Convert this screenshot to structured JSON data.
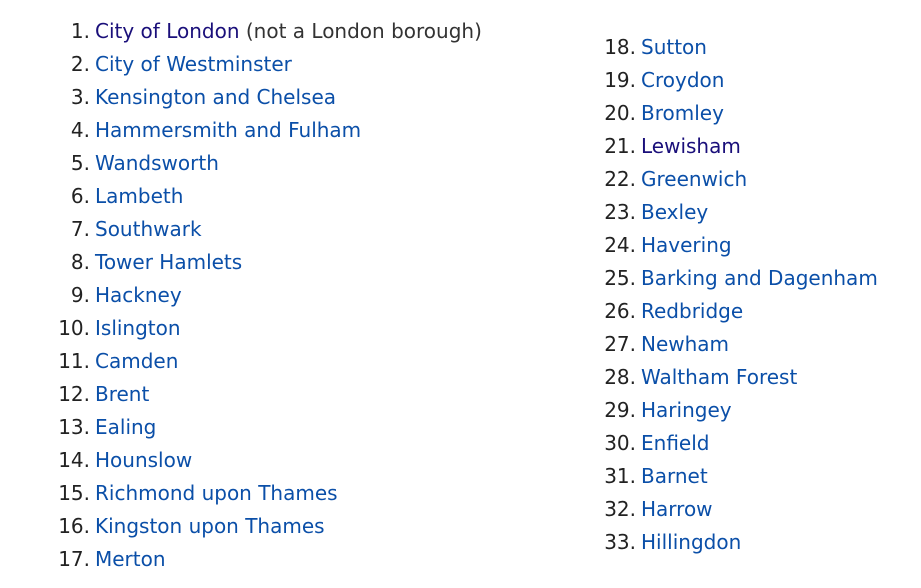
{
  "colors": {
    "link": "#0b4fa8",
    "visited_link": "#1a0f7a",
    "text": "#222222"
  },
  "left_list": [
    {
      "num": "1.",
      "name": "City of London",
      "note": " (not a London borough)",
      "visited": true
    },
    {
      "num": "2.",
      "name": "City of Westminster"
    },
    {
      "num": "3.",
      "name": "Kensington and Chelsea"
    },
    {
      "num": "4.",
      "name": "Hammersmith and Fulham"
    },
    {
      "num": "5.",
      "name": "Wandsworth"
    },
    {
      "num": "6.",
      "name": "Lambeth"
    },
    {
      "num": "7.",
      "name": "Southwark"
    },
    {
      "num": "8.",
      "name": "Tower Hamlets"
    },
    {
      "num": "9.",
      "name": "Hackney"
    },
    {
      "num": "10.",
      "name": "Islington"
    },
    {
      "num": "11.",
      "name": "Camden"
    },
    {
      "num": "12.",
      "name": "Brent"
    },
    {
      "num": "13.",
      "name": "Ealing"
    },
    {
      "num": "14.",
      "name": "Hounslow"
    },
    {
      "num": "15.",
      "name": "Richmond upon Thames"
    },
    {
      "num": "16.",
      "name": "Kingston upon Thames"
    },
    {
      "num": "17.",
      "name": "Merton"
    }
  ],
  "right_list": [
    {
      "num": "18.",
      "name": "Sutton"
    },
    {
      "num": "19.",
      "name": "Croydon"
    },
    {
      "num": "20.",
      "name": "Bromley"
    },
    {
      "num": "21.",
      "name": "Lewisham",
      "visited": true
    },
    {
      "num": "22.",
      "name": "Greenwich"
    },
    {
      "num": "23.",
      "name": "Bexley"
    },
    {
      "num": "24.",
      "name": "Havering"
    },
    {
      "num": "25.",
      "name": "Barking and Dagenham"
    },
    {
      "num": "26.",
      "name": "Redbridge"
    },
    {
      "num": "27.",
      "name": "Newham"
    },
    {
      "num": "28.",
      "name": "Waltham Forest"
    },
    {
      "num": "29.",
      "name": "Haringey"
    },
    {
      "num": "30.",
      "name": "Enfield"
    },
    {
      "num": "31.",
      "name": "Barnet"
    },
    {
      "num": "32.",
      "name": "Harrow"
    },
    {
      "num": "33.",
      "name": "Hillingdon"
    }
  ]
}
